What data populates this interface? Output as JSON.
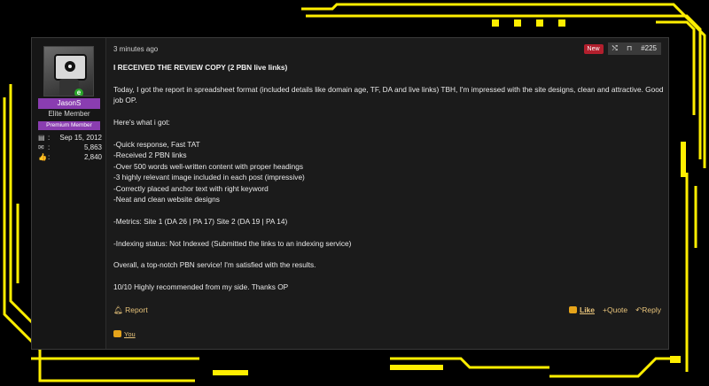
{
  "post": {
    "time": "3 minutes ago",
    "new_badge": "New",
    "share_icon": "share-icon",
    "bookmark_icon": "bookmark-icon",
    "number": "#225",
    "title": "I RECEIVED THE REVIEW COPY (2 PBN live links)",
    "paragraphs": [
      "Today, I got the report in spreadsheet format (included details like domain age, TF, DA and live links) TBH, I'm impressed with the site designs, clean and attractive. Good job OP.",
      "Here's what i got:"
    ],
    "list": [
      "-Quick response, Fast TAT",
      "-Received 2 PBN links",
      "-Over 500 words well-written content with proper headings",
      "-3 highly relevant image included in each post (impressive)",
      "-Correctly placed anchor text with right keyword",
      "-Neat and clean website designs"
    ],
    "metrics": "-Metrics: Site 1 (DA 26 | PA 17) Site 2 (DA 19 | PA 14)",
    "indexing": "-Indexing status: Not Indexed (Submitted the links to an indexing service)",
    "overall": "Overall, a top-notch PBN service! I'm satisfied with the results.",
    "rating": "10/10 Highly recommended from my side. Thanks OP",
    "report_label": "Report",
    "like_label": "Like",
    "quote_label": "+Quote",
    "reply_label": "Reply",
    "reaction_you": "You"
  },
  "user": {
    "name": "JasonS",
    "title": "Elite Member",
    "banner": "Premium Member",
    "joined": "Sep 15, 2012",
    "messages": "5,863",
    "reactions": "2,840"
  },
  "colors": {
    "accent": "#e6c27a",
    "frame": "#ffee00",
    "username_bg": "#8a3db0",
    "new_badge": "#b21f2d"
  }
}
